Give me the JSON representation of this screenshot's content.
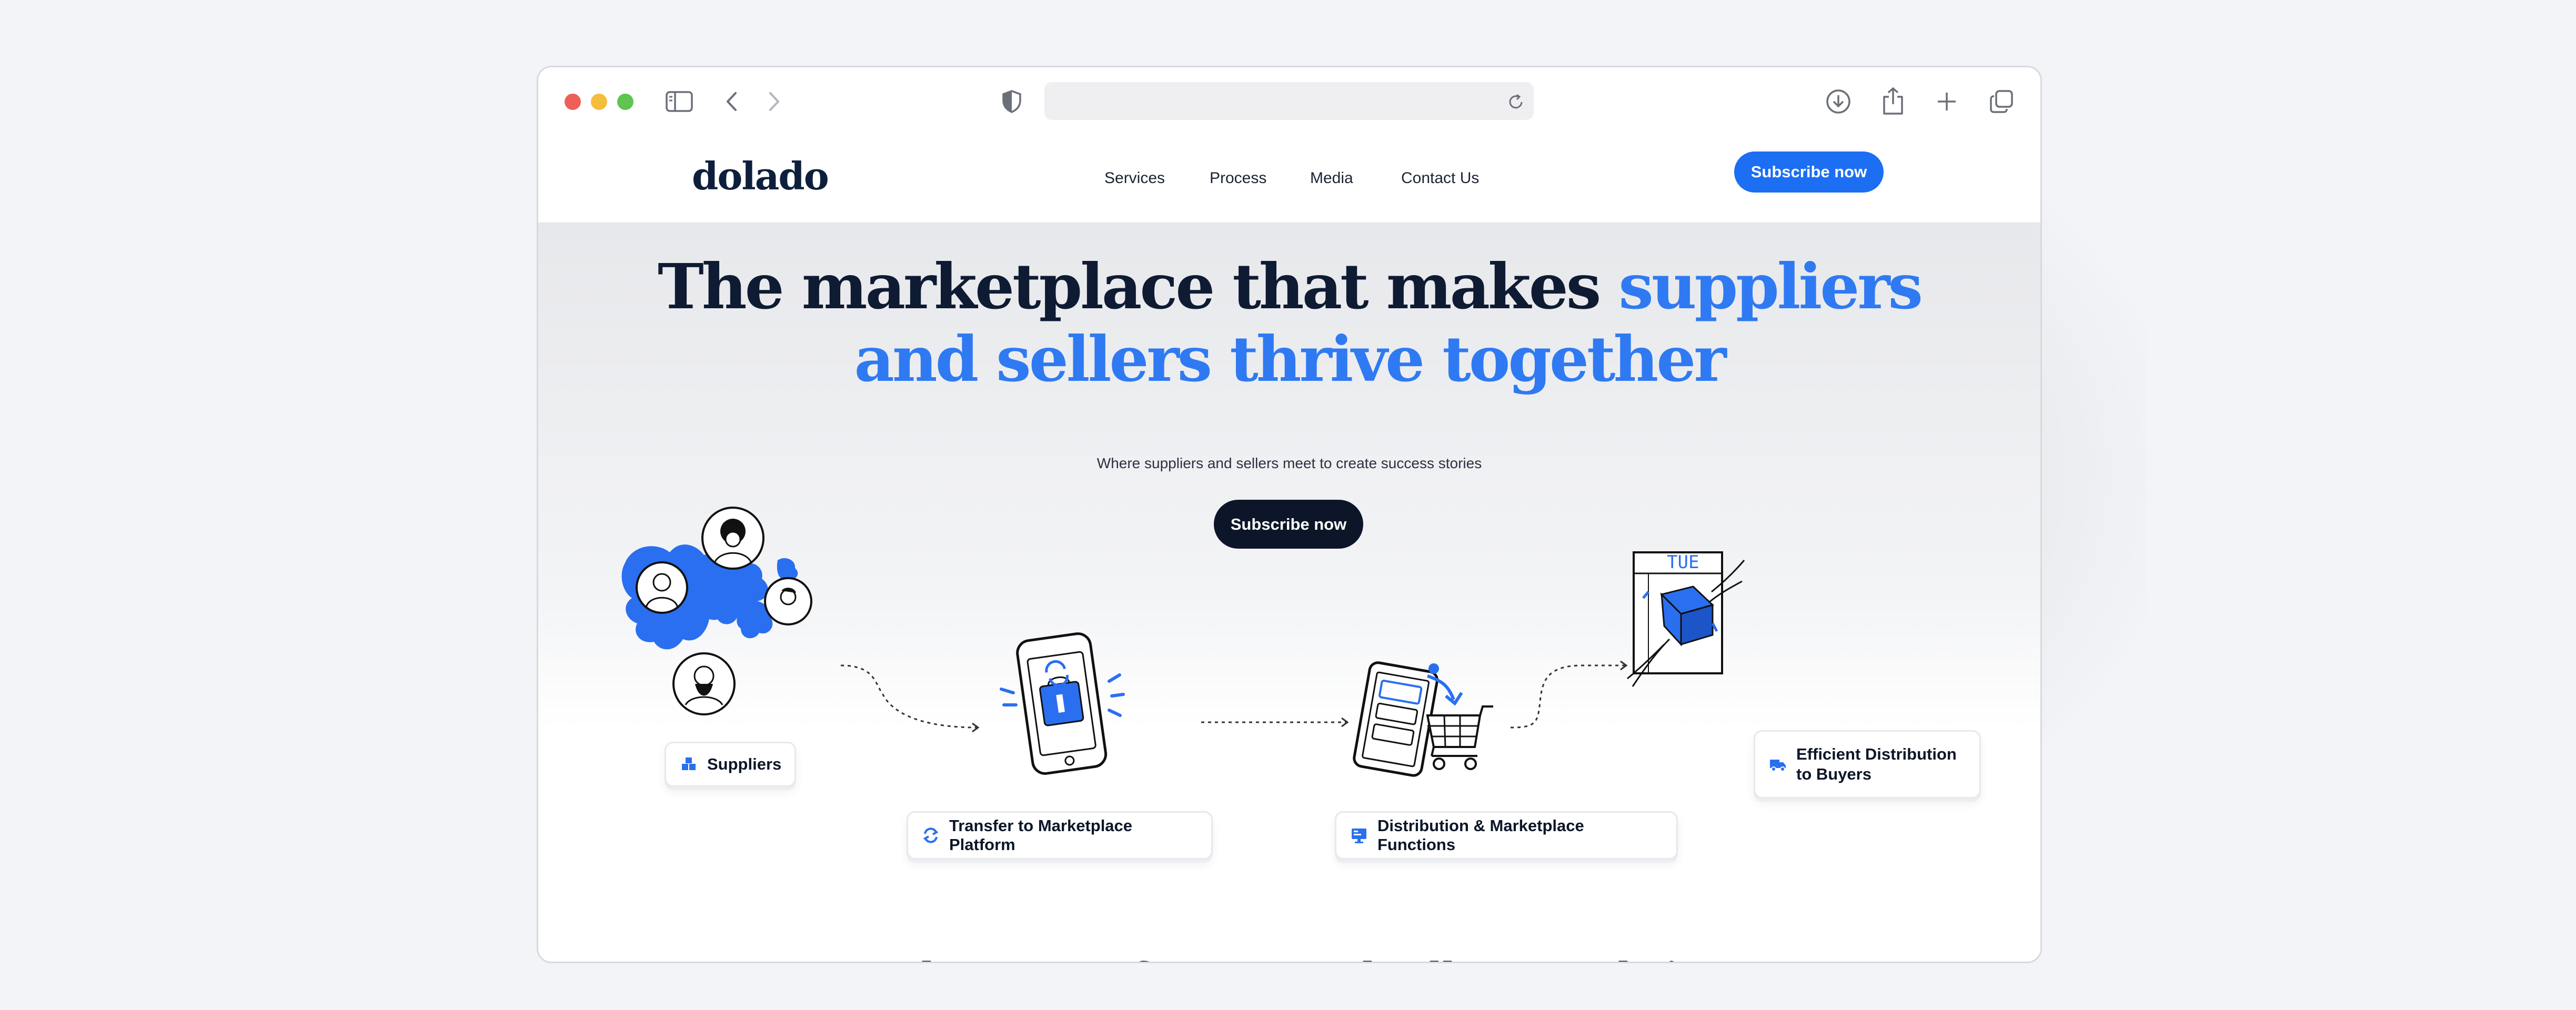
{
  "colors": {
    "accent": "#1c6ef2",
    "headline_accent": "#2f7af2",
    "dark": "#0c1628"
  },
  "browser": {
    "icons": [
      "close-dot",
      "minimize-dot",
      "zoom-dot",
      "sidebar-icon",
      "back-icon",
      "forward-icon",
      "privacy-shield-icon",
      "reload-icon",
      "download-icon",
      "share-icon",
      "new-tab-icon",
      "tabs-overview-icon"
    ]
  },
  "site": {
    "logo": "dolado",
    "nav": [
      "Services",
      "Process",
      "Media",
      "Contact Us"
    ],
    "subscribe_label": "Subscribe now"
  },
  "hero": {
    "headline_dark": "The marketplace that makes ",
    "headline_blue_1": "suppliers",
    "headline_blue_2": "and sellers thrive together",
    "subtitle": "Where suppliers and sellers meet to create success stories",
    "cta_label": "Subscribe now",
    "calendar_label": "TUE"
  },
  "flow": {
    "steps": [
      {
        "label": "Suppliers",
        "icon": "boxes-icon"
      },
      {
        "label": "Transfer to Marketplace Platform",
        "icon": "exchange-arrows-icon"
      },
      {
        "label": "Distribution & Marketplace Functions",
        "icon": "monitor-icon"
      },
      {
        "label_line1": "Efficient Distribution",
        "label_line2": "to Buyers",
        "icon": "truck-icon"
      }
    ]
  },
  "section2": {
    "heading_partial": "Where Manufacturer and sellers get their"
  }
}
